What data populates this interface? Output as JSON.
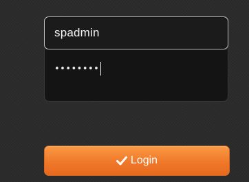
{
  "form": {
    "username": {
      "value": "spadmin"
    },
    "password": {
      "masked_value": "••••••••",
      "length": 8
    }
  },
  "login_button": {
    "label": "Login",
    "icon": "check-icon"
  },
  "colors": {
    "background": "#2b2b2b",
    "input_background": "#1b1b1b",
    "button_orange": "#f0782a",
    "text_light": "#f2f2f2"
  }
}
